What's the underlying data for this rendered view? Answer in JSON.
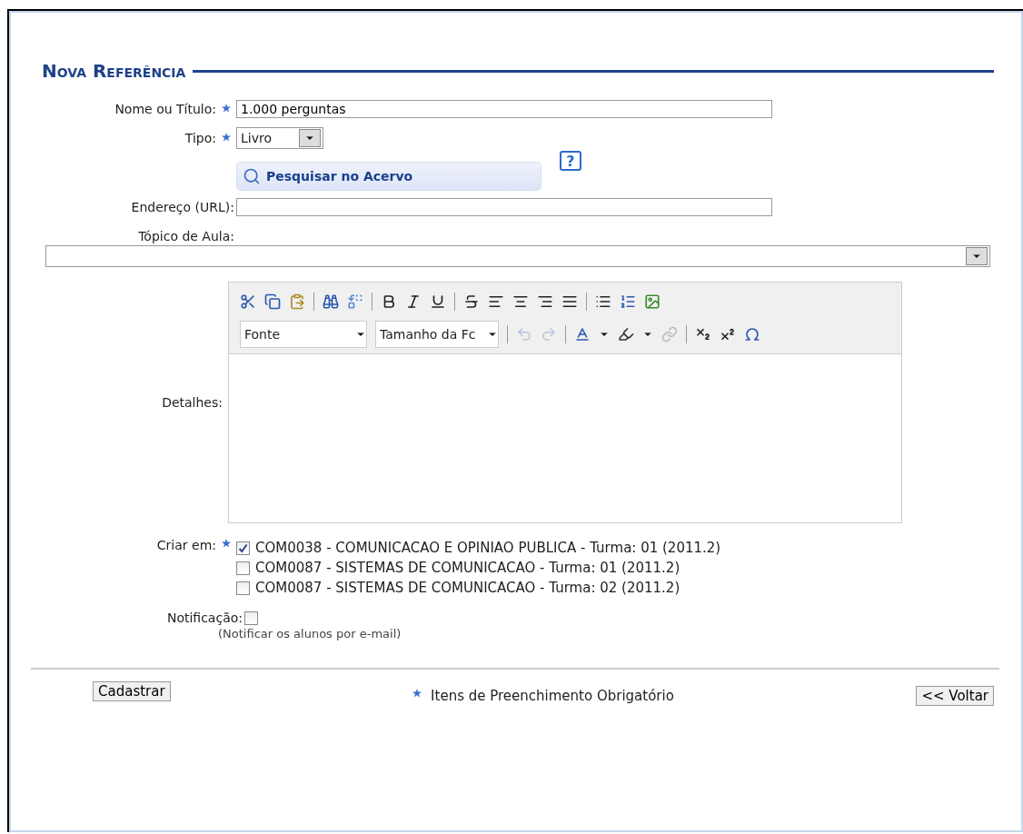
{
  "title": "Nova Referência",
  "fields": {
    "nome": {
      "label": "Nome ou Título:",
      "required": true,
      "value": "1.000 perguntas"
    },
    "tipo": {
      "label": "Tipo:",
      "required": true,
      "value": "Livro"
    },
    "search_button": "Pesquisar no Acervo",
    "help": "?",
    "url": {
      "label": "Endereço (URL):"
    },
    "topico": {
      "label": "Tópico de Aula:"
    }
  },
  "editor": {
    "label": "Detalhes:",
    "font": "Fonte",
    "size": "Tamanho da Fc"
  },
  "criar_em": {
    "label": "Criar em:",
    "required": true,
    "options": [
      {
        "text": "COM0038 - COMUNICACAO E OPINIAO PUBLICA - Turma: 01 (2011.2)",
        "checked": true
      },
      {
        "text": "COM0087 - SISTEMAS DE COMUNICACAO - Turma: 01 (2011.2)",
        "checked": false
      },
      {
        "text": "COM0087 - SISTEMAS DE COMUNICACAO - Turma: 02 (2011.2)",
        "checked": false
      }
    ]
  },
  "notificacao": {
    "label": "Notificação:",
    "checked": false,
    "hint": "(Notificar os alunos por e-mail)"
  },
  "footer": {
    "submit": "Cadastrar",
    "required_note": "Itens de Preenchimento Obrigatório",
    "back": "<< Voltar"
  }
}
